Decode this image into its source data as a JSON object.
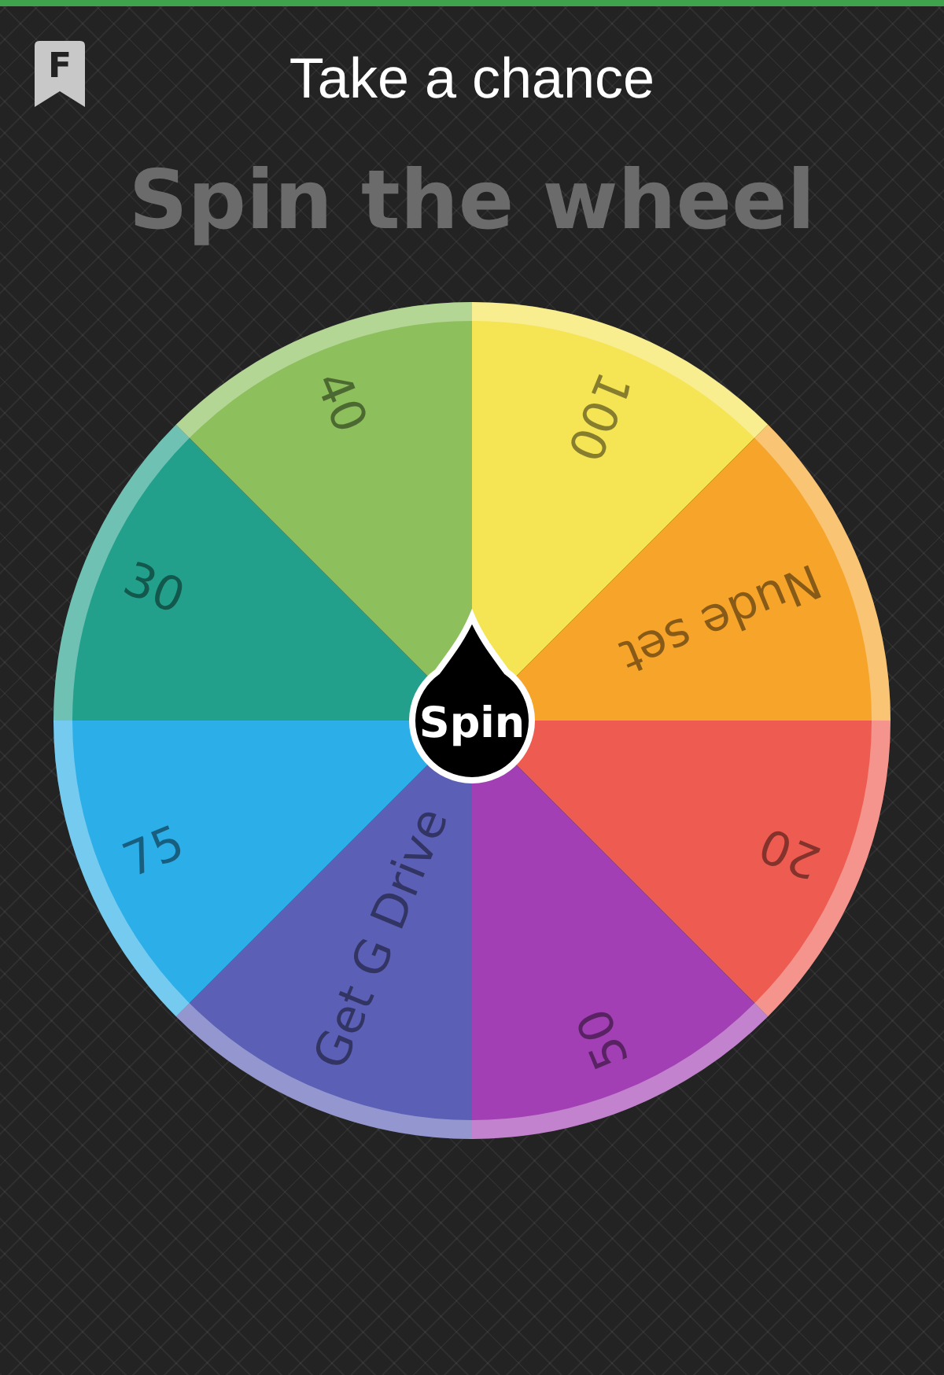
{
  "header": {
    "badge": "F",
    "title": "Take a chance"
  },
  "heading": "Spin the wheel",
  "wheel": {
    "segments": [
      {
        "label": "100",
        "color": "#f5e454"
      },
      {
        "label": "Nude set",
        "color": "#f6a52a"
      },
      {
        "label": "20",
        "color": "#ee5b50"
      },
      {
        "label": "50",
        "color": "#a23fb4"
      },
      {
        "label": "Get G Drive",
        "color": "#5b60b6"
      },
      {
        "label": "75",
        "color": "#2caee8"
      },
      {
        "label": "30",
        "color": "#23a08c"
      },
      {
        "label": "40",
        "color": "#8dc05c"
      }
    ],
    "button": "Spin"
  }
}
